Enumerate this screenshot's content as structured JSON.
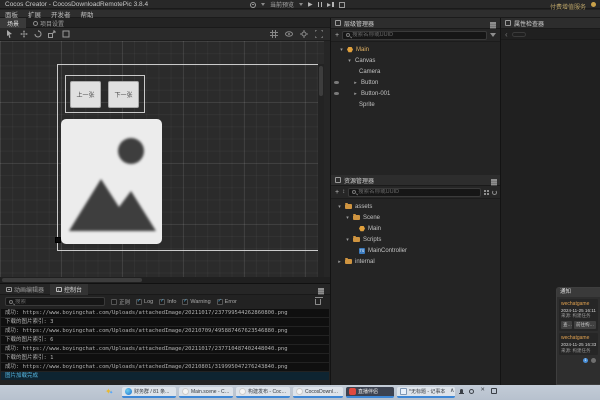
{
  "titlebar": {
    "title": "Cocos Creator - CocosDownloadRemotePic 3.8.4",
    "preview_device": "当前预览",
    "premium": "付费增值服务"
  },
  "menubar": {
    "items": [
      "面板",
      "扩展",
      "开发者",
      "帮助"
    ]
  },
  "scene_tabs": {
    "scene": "场景",
    "project_settings": "项目设置"
  },
  "scene": {
    "prev_button": "上一张",
    "next_button": "下一张"
  },
  "hierarchy": {
    "title": "层级管理器",
    "search_placeholder": "搜索名称或UUID",
    "nodes": [
      {
        "label": "Main"
      },
      {
        "label": "Canvas"
      },
      {
        "label": "Camera"
      },
      {
        "label": "Button"
      },
      {
        "label": "Button-001"
      },
      {
        "label": "Sprite"
      }
    ]
  },
  "assets": {
    "title": "资源管理器",
    "search_placeholder": "搜索名称或UUID",
    "ts_badge": "TS",
    "nodes": [
      {
        "label": "assets"
      },
      {
        "label": "Scene"
      },
      {
        "label": "Main"
      },
      {
        "label": "Scripts"
      },
      {
        "label": "MainController"
      },
      {
        "label": "internal"
      }
    ]
  },
  "inspector": {
    "title": "属性检查器"
  },
  "console": {
    "tab_animation": "动画编辑器",
    "tab_console": "控制台",
    "search_placeholder": "搜索",
    "regex_label": "正则",
    "filter_log": "Log",
    "filter_info": "Info",
    "filter_warning": "Warning",
    "filter_error": "Error",
    "check_mark": "✓",
    "logs": [
      {
        "text": "成功: https://www.boyingchat.com/Uploads/attachedImage/20211017/237799544262860800.png"
      },
      {
        "text": "下载的图片索引: 3"
      },
      {
        "text": "成功: https://www.boyingchat.com/Uploads/attachedImage/20210709/495887467623546880.png"
      },
      {
        "text": "下载的图片索引: 6"
      },
      {
        "text": "成功: https://www.boyingchat.com/Uploads/attachedImage/20211017/237710487402448040.png"
      },
      {
        "text": "下载的图片索引: 1"
      },
      {
        "text": "成功: https://www.boyingchat.com/Uploads/attachedImage/20210801/319995047276243840.png"
      },
      {
        "text": "图片加载完成"
      }
    ]
  },
  "notifications": {
    "title": "通知",
    "badge": "1",
    "items": [
      {
        "app": "wechatgame",
        "time": "2024-11-25 16:11:5",
        "source": "来源: 构建任务",
        "action1": "查看",
        "action2": "前往构建面板"
      },
      {
        "app": "wechatgame",
        "time": "2024-11-25 16:33:4",
        "source": "来源: 构建任务"
      }
    ]
  },
  "taskbar": {
    "items": [
      {
        "label": "财务群 / 81 条..."
      },
      {
        "label": "Main.scene - Co..."
      },
      {
        "label": "构建发布 - Coco..."
      },
      {
        "label": "CocosDownloadR..."
      },
      {
        "label": "直播伴侣"
      },
      {
        "label": "*无标题 - 记事本"
      }
    ]
  },
  "colors": {
    "accent_blue": "#4aa3df",
    "folder_orange": "#cf9440",
    "scene_orange": "#e2a13c",
    "log_selected": "#58b7e0"
  }
}
